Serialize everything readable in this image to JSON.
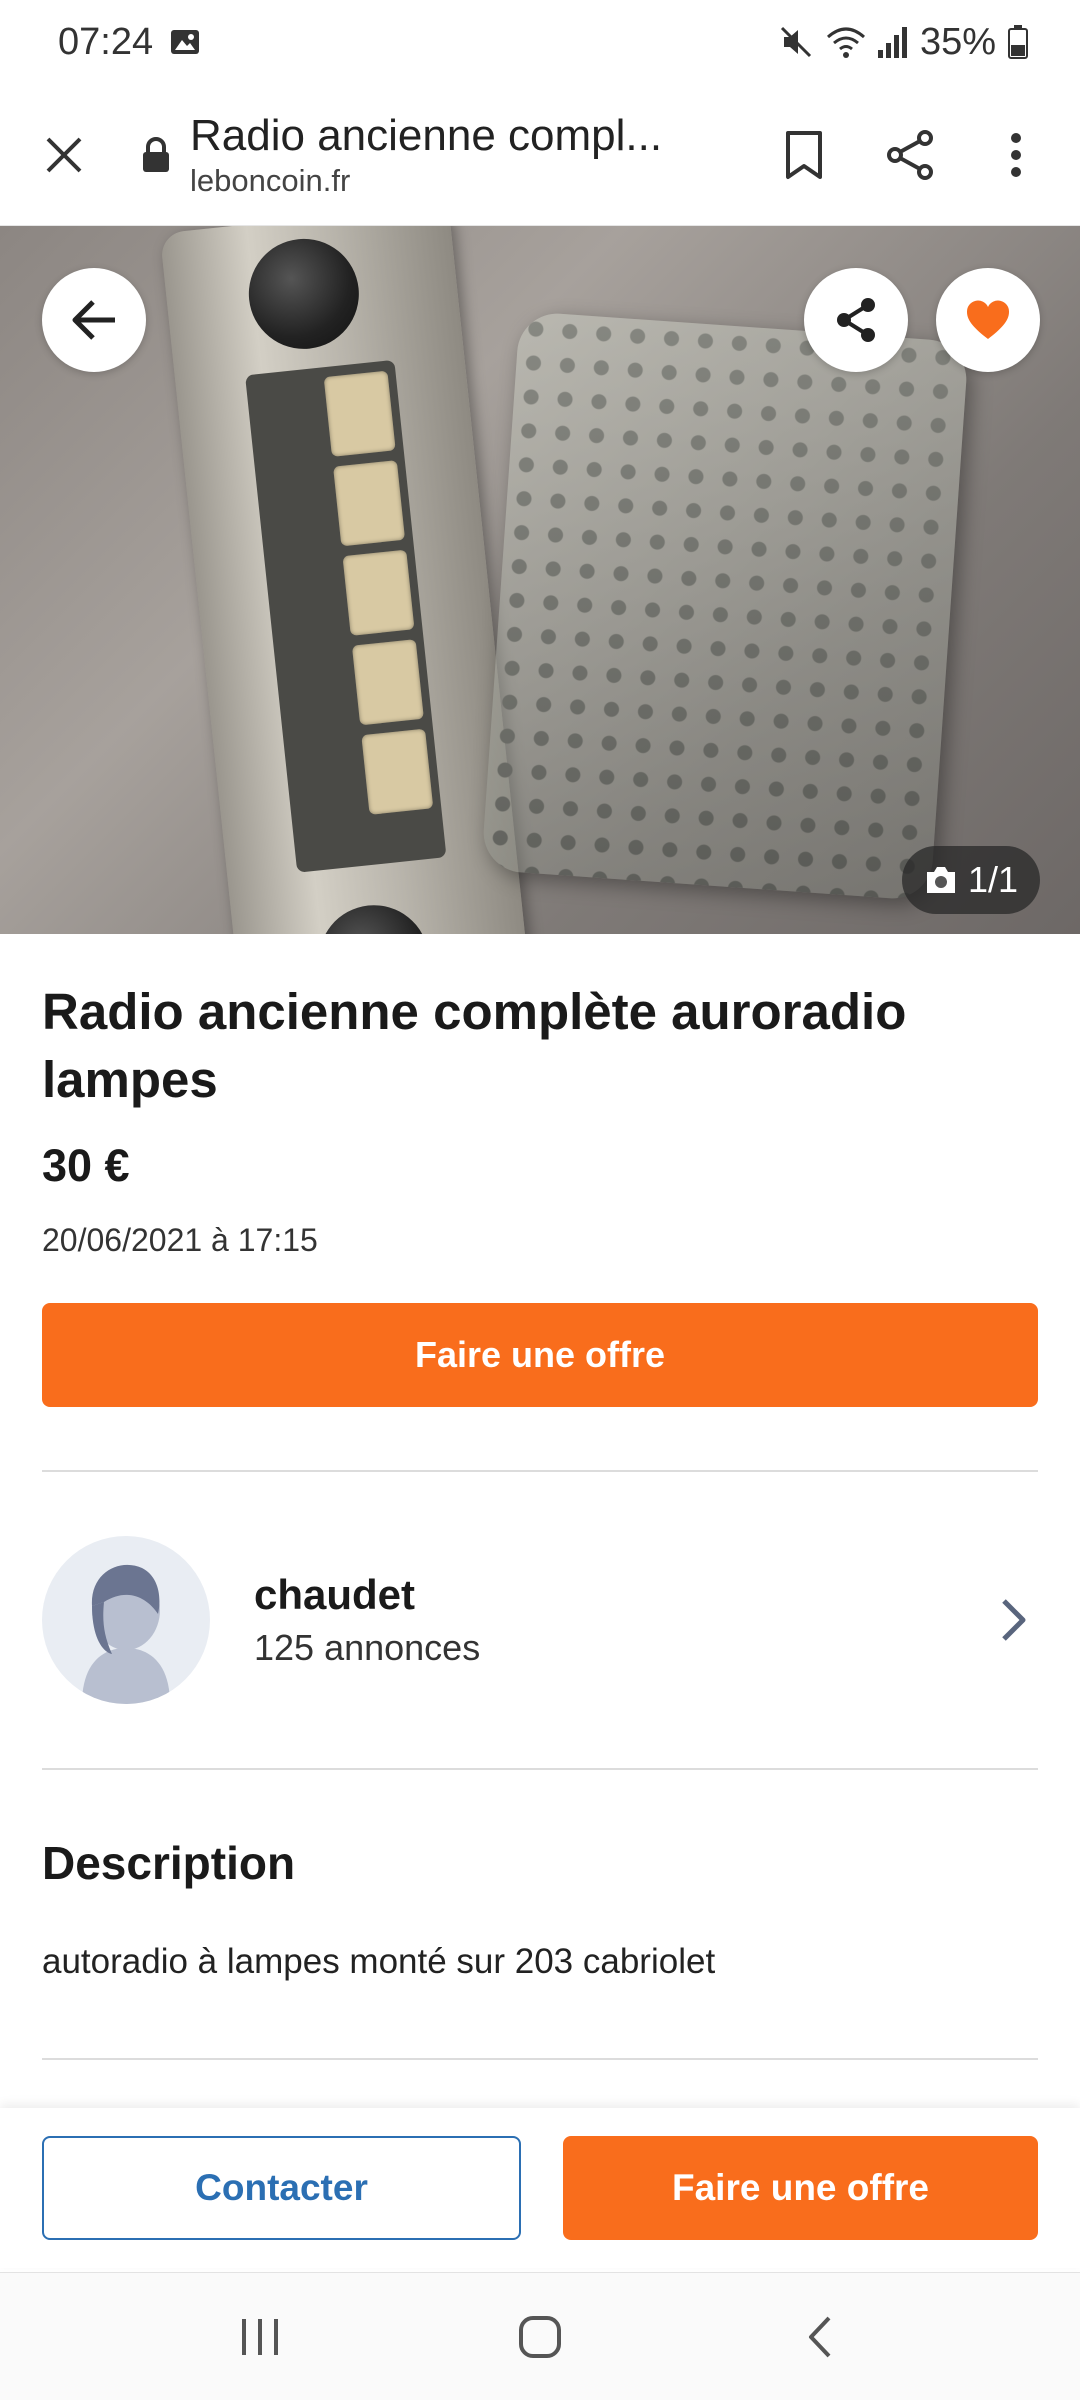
{
  "status_bar": {
    "time": "07:24",
    "battery": "35%",
    "icons": [
      "gallery-icon",
      "mute-icon",
      "wifi-icon",
      "signal-icon",
      "battery-icon"
    ]
  },
  "browser": {
    "page_title": "Radio ancienne compl...",
    "domain": "leboncoin.fr",
    "icons": [
      "close-icon",
      "lock-icon",
      "bookmark-icon",
      "share-icon",
      "more-icon"
    ]
  },
  "gallery": {
    "photo_counter": "1/1",
    "icons": [
      "back-arrow-icon",
      "share-icon",
      "heart-icon",
      "camera-icon"
    ]
  },
  "ad": {
    "title": "Radio ancienne complète auroradio lampes",
    "price": "30 €",
    "date": "20/06/2021 à 17:15",
    "offer_button": "Faire une offre"
  },
  "seller": {
    "name": "chaudet",
    "listings": "125 annonces"
  },
  "description": {
    "heading": "Description",
    "text": "autoradio à lampes monté sur 203 cabriolet"
  },
  "actions": {
    "contact": "Contacter",
    "offer": "Faire une offre"
  },
  "colors": {
    "accent_orange": "#f96d1c",
    "link_blue": "#2b6fb3"
  }
}
